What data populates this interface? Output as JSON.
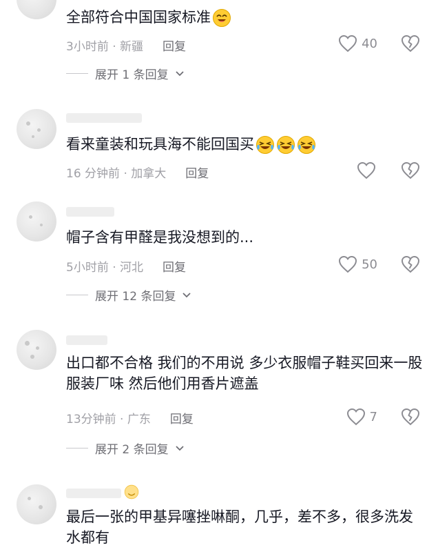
{
  "comments": [
    {
      "text": "全部符合中国国家标准",
      "time": "3小时前 · 新疆",
      "reply": "回复",
      "likes": "40",
      "expand": "展开 1 条回复"
    },
    {
      "text": "看来童装和玩具海不能回国买",
      "time": "16 分钟前 · 加拿大",
      "reply": "回复",
      "likes": "",
      "expand": ""
    },
    {
      "text": "帽子含有甲醛是我没想到的...",
      "time": "5小时前 · 河北",
      "reply": "回复",
      "likes": "50",
      "expand": "展开 12 条回复"
    },
    {
      "text": "出口都不合格 我们的不用说 多少衣服帽子鞋买回来一股服装厂味 然后他们用香片遮盖",
      "time": "13分钟前 · 广东",
      "reply": "回复",
      "likes": "7",
      "expand": "展开 2 条回复"
    },
    {
      "text": "最后一张的甲基异噻挫啉酮，几乎，差不多，很多洗发水都有",
      "time": "",
      "reply": "",
      "likes": "",
      "expand": ""
    }
  ],
  "icons": {
    "like": "heart-outline-icon",
    "dislike": "broken-heart-icon",
    "expand": "chevron-down-icon",
    "emoji_smile": "smiling-face-emoji",
    "emoji_cry": "crying-laughing-emoji"
  },
  "colors": {
    "text": "#161823",
    "meta": "#a0a0a6",
    "reply": "#6e6e74",
    "icon": "#8c8c92"
  }
}
